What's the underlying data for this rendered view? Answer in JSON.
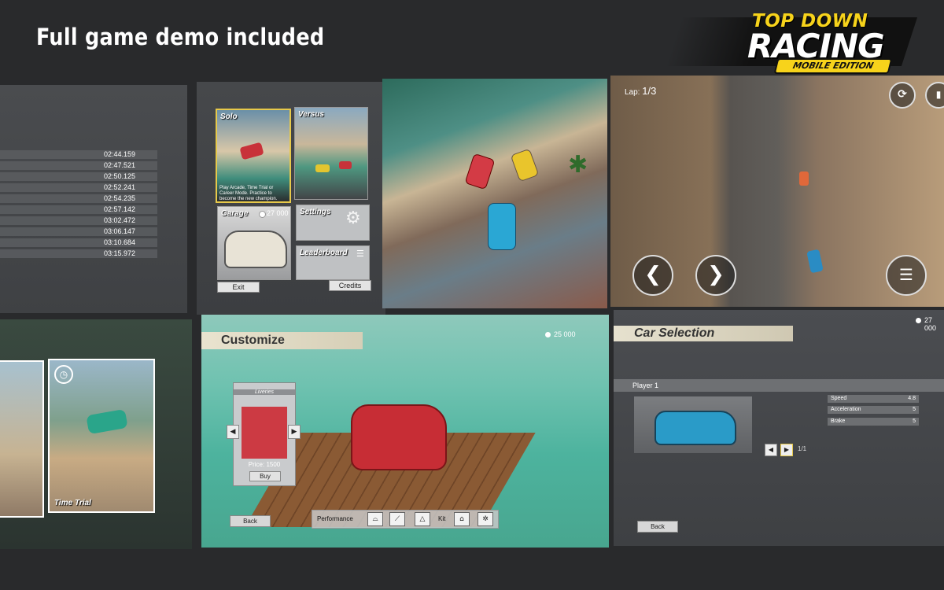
{
  "header": {
    "tagline": "Full game demo included",
    "logo_top": "TOP DOWN",
    "logo_main": "RACING",
    "logo_badge": "MOBILE EDITION"
  },
  "leaderboard": {
    "times": [
      "02:44.159",
      "02:47.521",
      "02:50.125",
      "02:52.241",
      "02:54.235",
      "02:57.142",
      "03:02.472",
      "03:06.147",
      "03:10.684",
      "03:15.972"
    ]
  },
  "main_menu": {
    "solo_label": "Solo",
    "solo_desc": "Play Arcade, Time Trial or Career Mode. Practice to become the new champion.",
    "versus_label": "Versus",
    "garage_label": "Garage",
    "garage_coins": "27 000",
    "settings_label": "Settings",
    "leaderboard_label": "Leaderboard",
    "exit_label": "Exit",
    "credits_label": "Credits"
  },
  "race_hud": {
    "lap_prefix": "Lap:",
    "lap_value": "1/3"
  },
  "time_trial": {
    "label": "Time Trial"
  },
  "customize": {
    "title": "Customize",
    "coins": "25 000",
    "liveries_label": "Liveries",
    "price": "Price: 1500",
    "buy_label": "Buy",
    "back_label": "Back",
    "performance_label": "Performance",
    "kit_label": "Kit"
  },
  "car_selection": {
    "title": "Car Selection",
    "coins": "27 000",
    "player_label": "Player 1",
    "stats": [
      {
        "name": "Speed",
        "value": "4.8"
      },
      {
        "name": "Acceleration",
        "value": "5"
      },
      {
        "name": "Brake",
        "value": "5"
      }
    ],
    "page_indicator": "1/1",
    "back_label": "Back"
  }
}
